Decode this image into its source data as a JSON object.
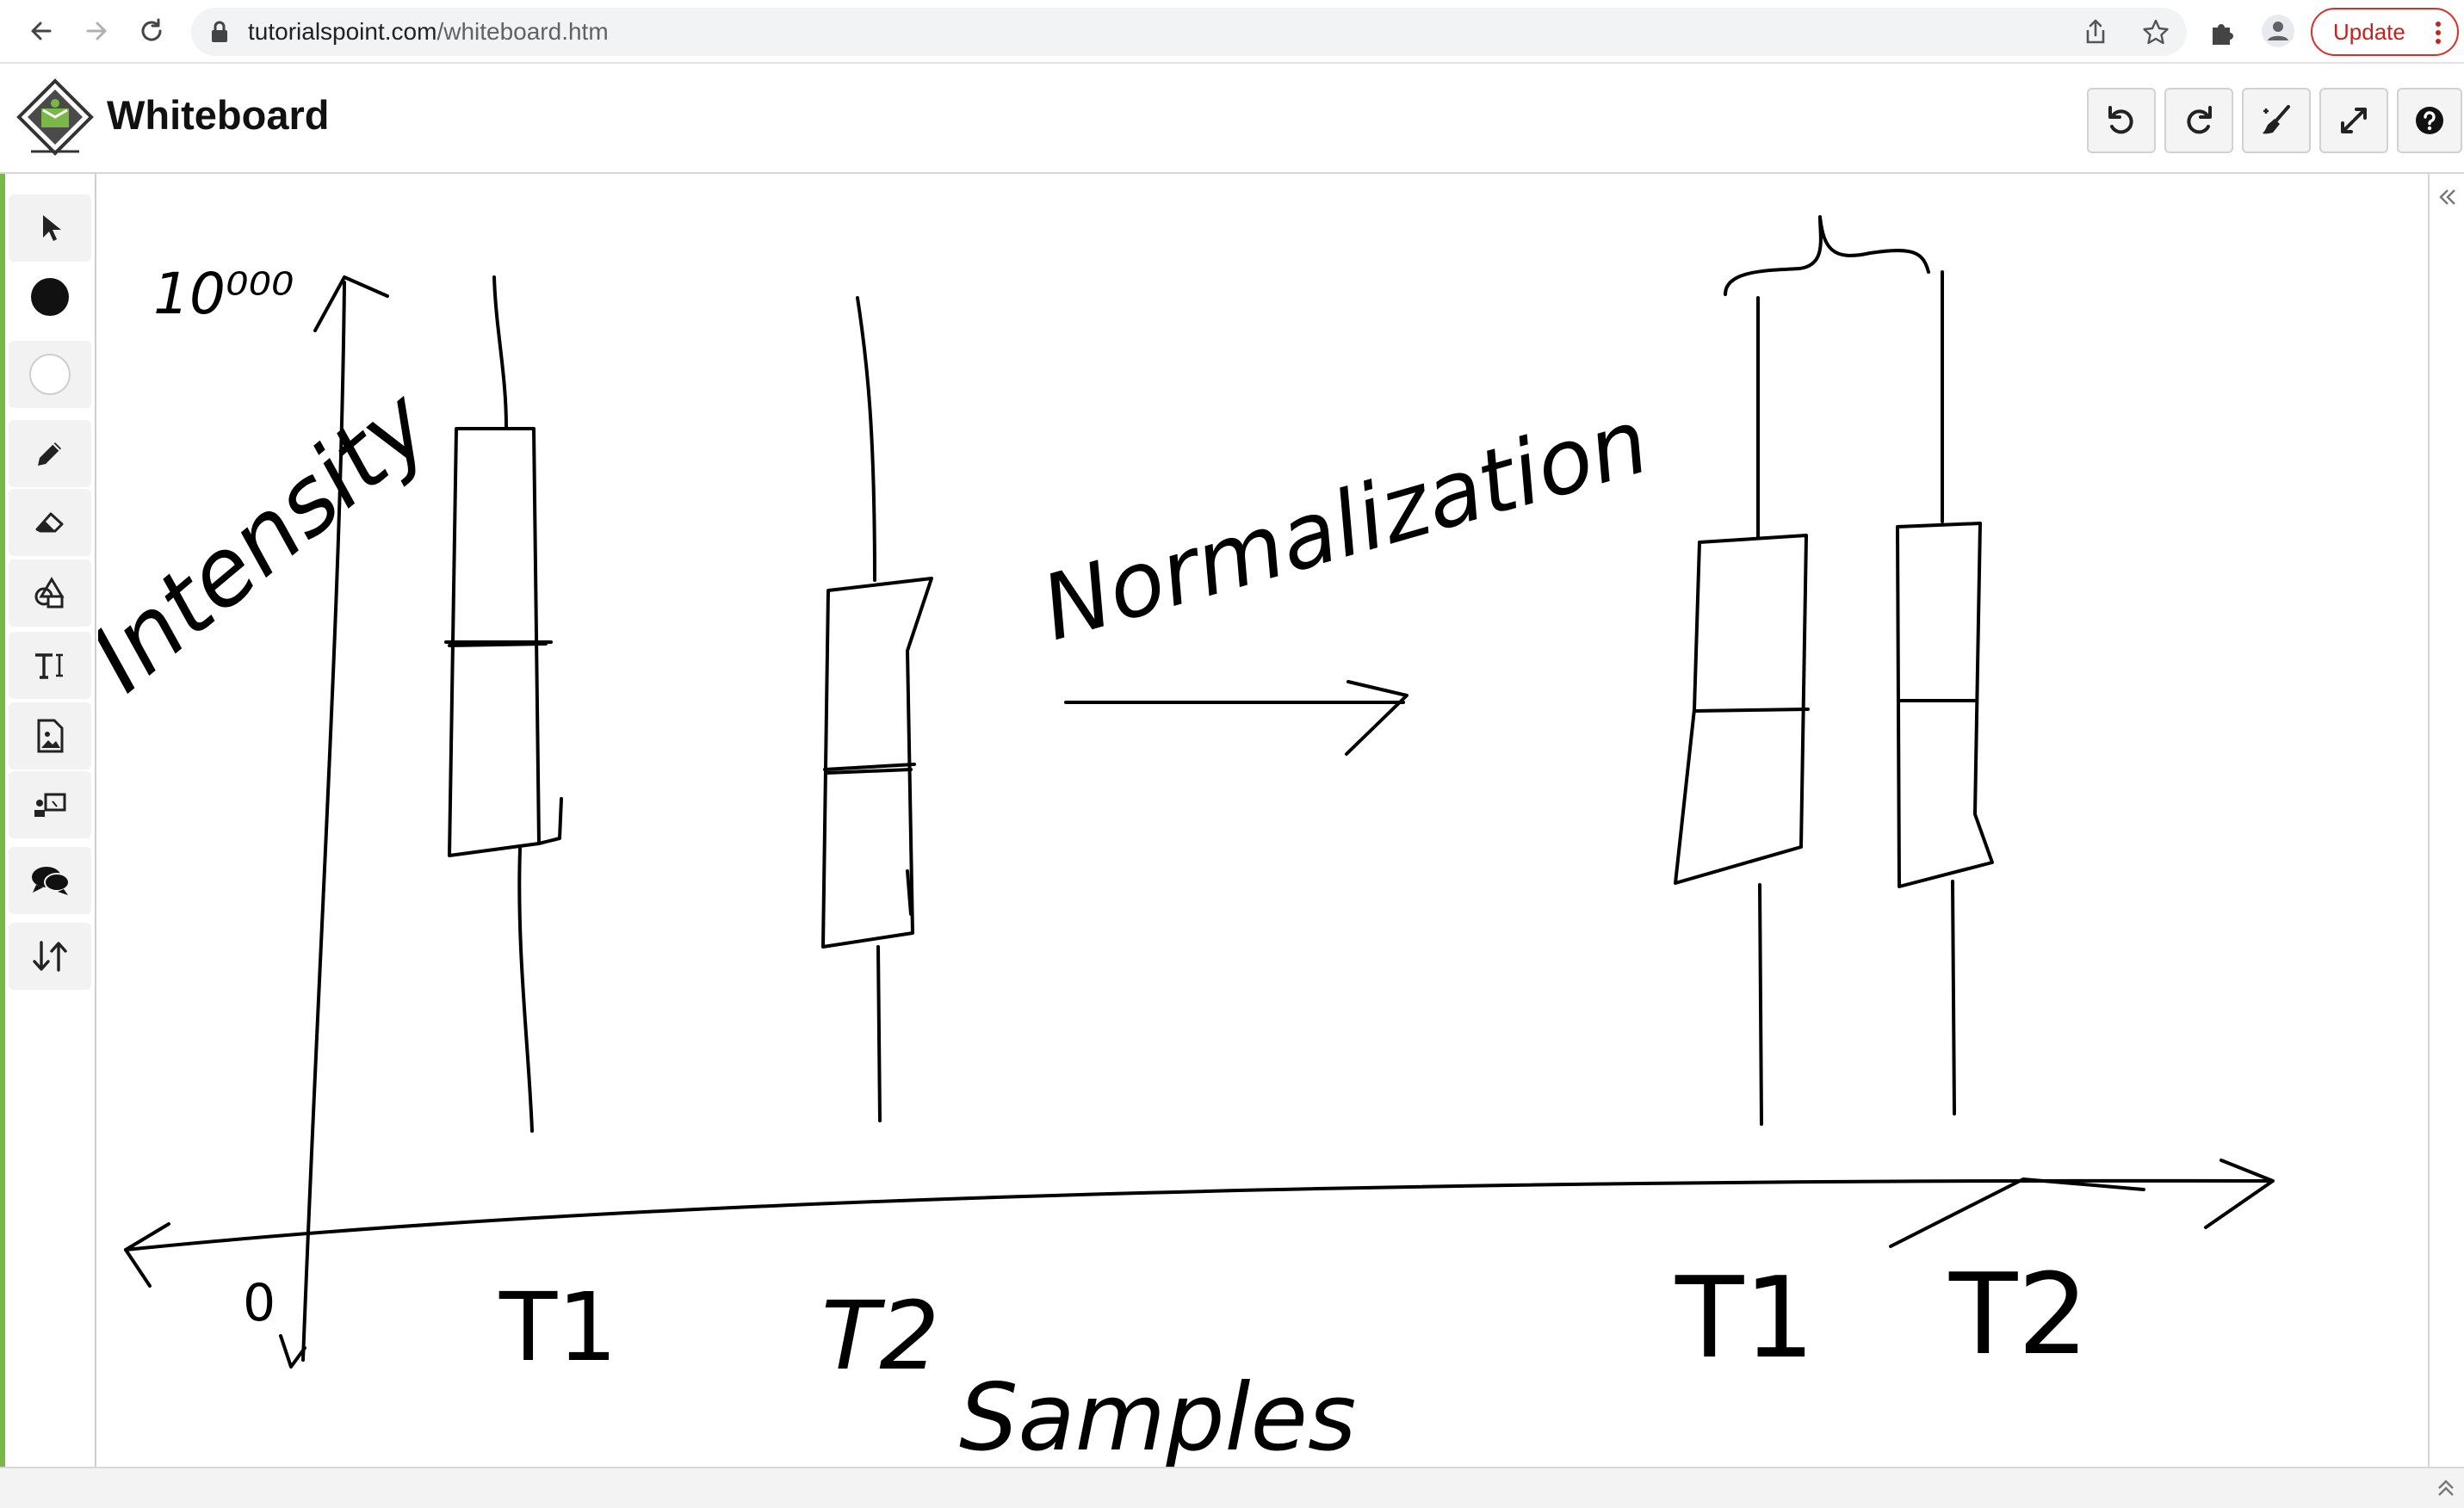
{
  "browser": {
    "url_host": "tutorialspoint.com",
    "url_path": "/whiteboard.htm",
    "update_label": "Update",
    "icons": [
      "back-arrow-icon",
      "forward-arrow-icon",
      "reload-icon",
      "lock-icon",
      "share-icon",
      "star-icon",
      "extensions-icon",
      "profile-icon",
      "more-vert-icon"
    ]
  },
  "app": {
    "title": "Whiteboard",
    "top_tools": [
      "undo-icon",
      "redo-icon",
      "clear-brush-icon",
      "fullscreen-icon",
      "help-icon"
    ]
  },
  "toolbar": {
    "tools": [
      "pointer",
      "color-black",
      "color-white",
      "pencil",
      "eraser",
      "shapes",
      "text",
      "image",
      "whiteboard-image",
      "chat",
      "swap-up-down"
    ]
  },
  "drawing": {
    "axis_top_label": "10⁰⁰⁰",
    "y_axis_label": "Intensity",
    "x_axis_label": "Samples",
    "origin_label": "0",
    "center_label": "Normalization",
    "ticks": [
      "T1",
      "T2",
      "T1",
      "T2"
    ]
  },
  "colors": {
    "ink": "#000000",
    "accent_green": "#7ab648",
    "update_red": "#d93025"
  }
}
